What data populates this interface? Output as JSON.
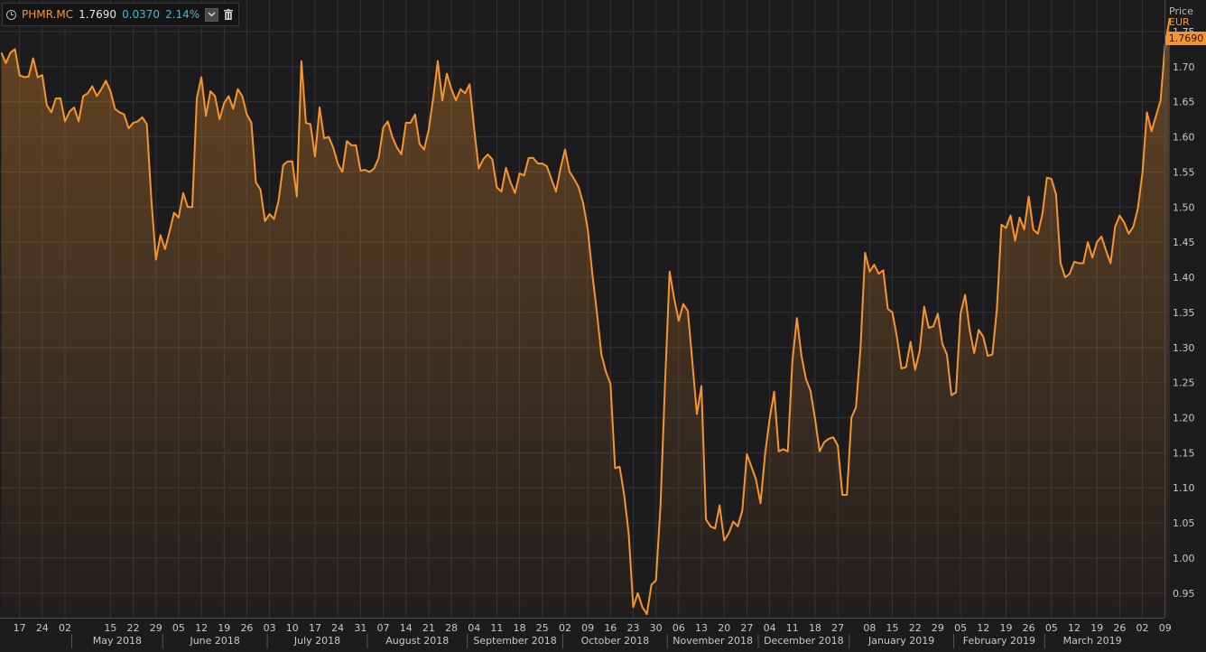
{
  "legend": {
    "ric": "PHMR.MC",
    "last": "1.7690",
    "change": "0.0370",
    "change_pct": "2.14%",
    "icons": [
      "clock-icon",
      "chevron-down-icon",
      "trash-icon"
    ]
  },
  "axis_header": {
    "price_label": "Price",
    "currency": "EUR"
  },
  "last_tag": "1.7690",
  "colors": {
    "line": "#f7952c",
    "background": "#1c1c1e",
    "grid": "#333333",
    "text": "#c8c8c8",
    "change": "#2bbfe8"
  },
  "chart_data": {
    "type": "area",
    "series": [
      {
        "name": "PHMR.MC",
        "values": [
          1.72,
          1.705,
          1.72,
          1.725,
          1.688,
          1.685,
          1.686,
          1.712,
          1.685,
          1.688,
          1.645,
          1.635,
          1.655,
          1.655,
          1.622,
          1.636,
          1.642,
          1.622,
          1.658,
          1.662,
          1.672,
          1.658,
          1.668,
          1.68,
          1.665,
          1.64,
          1.635,
          1.632,
          1.612,
          1.62,
          1.622,
          1.628,
          1.618,
          1.51,
          1.425,
          1.46,
          1.44,
          1.465,
          1.492,
          1.485,
          1.52,
          1.5,
          1.5,
          1.655,
          1.685,
          1.63,
          1.665,
          1.658,
          1.625,
          1.648,
          1.658,
          1.64,
          1.668,
          1.658,
          1.632,
          1.62,
          1.535,
          1.525,
          1.48,
          1.49,
          1.483,
          1.51,
          1.56,
          1.565,
          1.565,
          1.515,
          1.708,
          1.62,
          1.618,
          1.572,
          1.642,
          1.598,
          1.6,
          1.585,
          1.562,
          1.55,
          1.594,
          1.588,
          1.588,
          1.552,
          1.553,
          1.55,
          1.555,
          1.57,
          1.613,
          1.622,
          1.6,
          1.585,
          1.575,
          1.62,
          1.62,
          1.632,
          1.59,
          1.582,
          1.61,
          1.655,
          1.708,
          1.652,
          1.69,
          1.668,
          1.652,
          1.668,
          1.662,
          1.675,
          1.612,
          1.555,
          1.568,
          1.575,
          1.568,
          1.528,
          1.522,
          1.556,
          1.535,
          1.52,
          1.548,
          1.545,
          1.57,
          1.57,
          1.562,
          1.562,
          1.558,
          1.54,
          1.522,
          1.555,
          1.582,
          1.55,
          1.54,
          1.528,
          1.505,
          1.468,
          1.405,
          1.35,
          1.29,
          1.265,
          1.248,
          1.128,
          1.13,
          1.09,
          1.035,
          0.93,
          0.95,
          0.93,
          0.92,
          0.962,
          0.968,
          1.075,
          1.25,
          1.408,
          1.37,
          1.338,
          1.362,
          1.352,
          1.28,
          1.205,
          1.245,
          1.055,
          1.045,
          1.042,
          1.075,
          1.025,
          1.035,
          1.052,
          1.045,
          1.068,
          1.148,
          1.13,
          1.112,
          1.078,
          1.148,
          1.198,
          1.237,
          1.152,
          1.155,
          1.152,
          1.28,
          1.342,
          1.288,
          1.255,
          1.238,
          1.198,
          1.152,
          1.165,
          1.17,
          1.172,
          1.16,
          1.09,
          1.09,
          1.2,
          1.215,
          1.3,
          1.435,
          1.408,
          1.418,
          1.405,
          1.41,
          1.355,
          1.35,
          1.315,
          1.27,
          1.272,
          1.308,
          1.268,
          1.295,
          1.358,
          1.328,
          1.33,
          1.348,
          1.305,
          1.29,
          1.232,
          1.236,
          1.348,
          1.375,
          1.325,
          1.292,
          1.325,
          1.315,
          1.288,
          1.29,
          1.355,
          1.475,
          1.47,
          1.488,
          1.452,
          1.485,
          1.468,
          1.515,
          1.468,
          1.462,
          1.49,
          1.542,
          1.54,
          1.518,
          1.42,
          1.4,
          1.405,
          1.422,
          1.42,
          1.42,
          1.45,
          1.428,
          1.45,
          1.458,
          1.438,
          1.42,
          1.472,
          1.488,
          1.478,
          1.462,
          1.472,
          1.498,
          1.548,
          1.635,
          1.608,
          1.63,
          1.652,
          1.732,
          1.769
        ]
      }
    ],
    "ylim": [
      0.915,
      1.795
    ],
    "yticks": [
      "0.95",
      "1.00",
      "1.05",
      "1.10",
      "1.15",
      "1.20",
      "1.25",
      "1.30",
      "1.35",
      "1.40",
      "1.45",
      "1.50",
      "1.55",
      "1.60",
      "1.65",
      "1.70",
      "1.75"
    ],
    "xticks": [
      {
        "i": 4,
        "label": "17"
      },
      {
        "i": 9,
        "label": "24"
      },
      {
        "i": 14,
        "label": "02"
      },
      {
        "i": 24,
        "label": "15"
      },
      {
        "i": 29,
        "label": "22"
      },
      {
        "i": 34,
        "label": "29"
      },
      {
        "i": 39,
        "label": "05"
      },
      {
        "i": 44,
        "label": "12"
      },
      {
        "i": 49,
        "label": "19"
      },
      {
        "i": 54,
        "label": "26"
      },
      {
        "i": 59,
        "label": "03"
      },
      {
        "i": 64,
        "label": "10"
      },
      {
        "i": 69,
        "label": "17"
      },
      {
        "i": 74,
        "label": "24"
      },
      {
        "i": 79,
        "label": "31"
      },
      {
        "i": 84,
        "label": "07"
      },
      {
        "i": 89,
        "label": "14"
      },
      {
        "i": 94,
        "label": "21"
      },
      {
        "i": 99,
        "label": "28"
      },
      {
        "i": 104,
        "label": "04"
      },
      {
        "i": 109,
        "label": "11"
      },
      {
        "i": 114,
        "label": "18"
      },
      {
        "i": 119,
        "label": "25"
      },
      {
        "i": 124,
        "label": "02"
      },
      {
        "i": 129,
        "label": "09"
      },
      {
        "i": 134,
        "label": "16"
      },
      {
        "i": 139,
        "label": "23"
      },
      {
        "i": 144,
        "label": "30"
      },
      {
        "i": 149,
        "label": "06"
      },
      {
        "i": 154,
        "label": "13"
      },
      {
        "i": 159,
        "label": "20"
      },
      {
        "i": 164,
        "label": "27"
      },
      {
        "i": 169,
        "label": "04"
      },
      {
        "i": 174,
        "label": "11"
      },
      {
        "i": 179,
        "label": "18"
      },
      {
        "i": 184,
        "label": "27"
      },
      {
        "i": 191,
        "label": "08"
      },
      {
        "i": 196,
        "label": "15"
      },
      {
        "i": 201,
        "label": "22"
      },
      {
        "i": 206,
        "label": "29"
      },
      {
        "i": 211,
        "label": "05"
      },
      {
        "i": 216,
        "label": "12"
      },
      {
        "i": 221,
        "label": "19"
      },
      {
        "i": 226,
        "label": "26"
      },
      {
        "i": 231,
        "label": "05"
      },
      {
        "i": 236,
        "label": "12"
      },
      {
        "i": 241,
        "label": "19"
      },
      {
        "i": 246,
        "label": "26"
      },
      {
        "i": 251,
        "label": "02"
      },
      {
        "i": 256,
        "label": "09"
      }
    ],
    "months": [
      {
        "start": 16,
        "end": 36,
        "label": "May 2018"
      },
      {
        "start": 36,
        "end": 59,
        "label": "June 2018"
      },
      {
        "start": 59,
        "end": 81,
        "label": "July 2018"
      },
      {
        "start": 81,
        "end": 103,
        "label": "August 2018"
      },
      {
        "start": 103,
        "end": 124,
        "label": "September 2018"
      },
      {
        "start": 124,
        "end": 147,
        "label": "October 2018"
      },
      {
        "start": 147,
        "end": 167,
        "label": "November 2018"
      },
      {
        "start": 167,
        "end": 187,
        "label": "December 2018"
      },
      {
        "start": 187,
        "end": 210,
        "label": "January 2019"
      },
      {
        "start": 210,
        "end": 230,
        "label": "February 2019"
      },
      {
        "start": 230,
        "end": 251,
        "label": "March 2019"
      }
    ],
    "grid": true
  }
}
